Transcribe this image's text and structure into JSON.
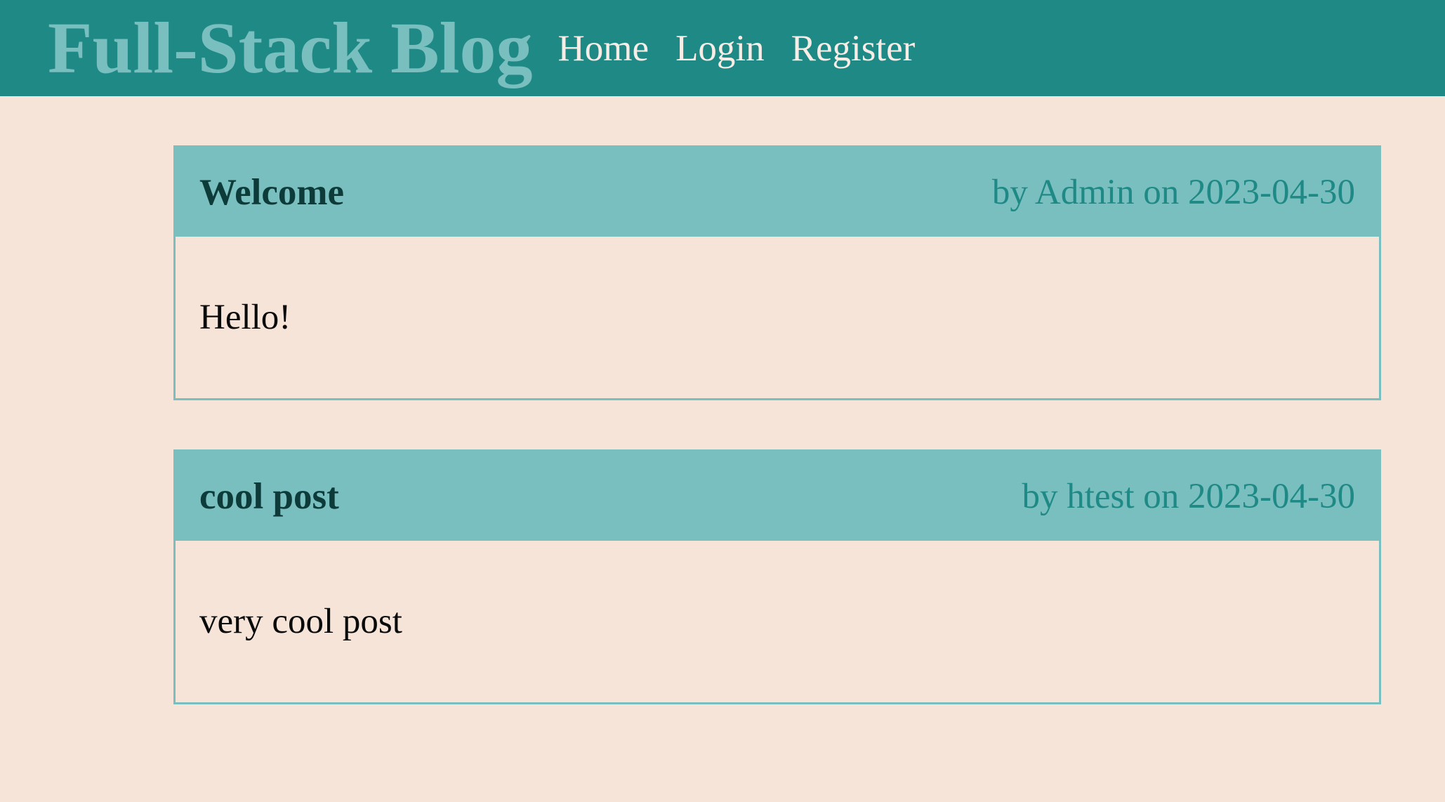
{
  "header": {
    "brand": "Full-Stack Blog",
    "nav": [
      {
        "label": "Home"
      },
      {
        "label": "Login"
      },
      {
        "label": "Register"
      }
    ]
  },
  "posts": [
    {
      "title": "Welcome",
      "meta": "by Admin on 2023-04-30",
      "body": "Hello!"
    },
    {
      "title": "cool post",
      "meta": "by htest on 2023-04-30",
      "body": "very cool post"
    }
  ],
  "colors": {
    "header_bg": "#1f8a85",
    "accent": "#7abfbf",
    "page_bg": "#f6e4d9"
  }
}
